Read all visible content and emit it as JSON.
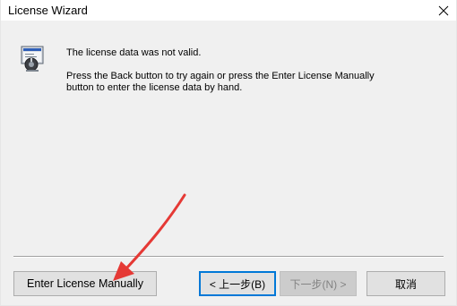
{
  "window": {
    "title": "License Wizard",
    "close_glyph": "✕"
  },
  "message": {
    "line1": "The license data was not valid.",
    "line2": "Press the Back button to try again or press the Enter License Manually",
    "line3": "button to enter the license data by hand."
  },
  "buttons": {
    "manual_label": "Enter License Manually",
    "back_label": "< 上一步(B)",
    "next_label": "下一步(N) >",
    "cancel_label": "取消",
    "next_enabled": false,
    "default_button": "back"
  },
  "icons": {
    "wizard": "license-wizard-icon",
    "close": "close-icon",
    "annotation": "red-arrow-annotation"
  },
  "colors": {
    "annotation_arrow": "#e53935",
    "focus_border": "#0078d7",
    "dialog_background": "#f0f0f0"
  }
}
